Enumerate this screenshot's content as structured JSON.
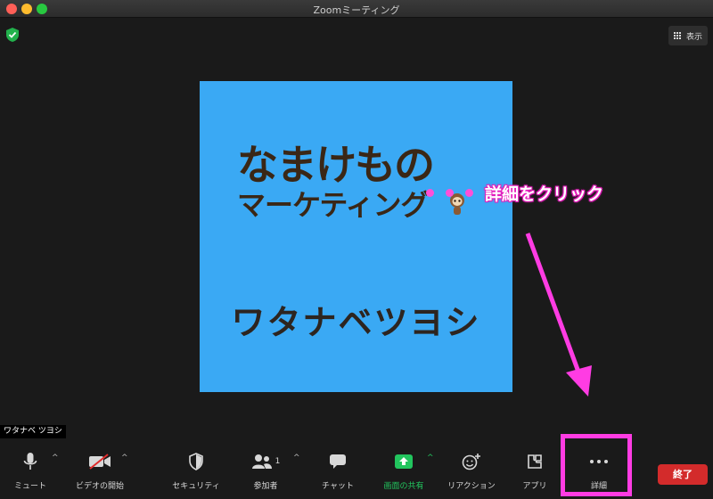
{
  "window": {
    "title": "Zoomミーティング"
  },
  "header": {
    "view_label": "表示"
  },
  "participant": {
    "logo_line1": "なまけもの",
    "logo_line2": "マーケティング",
    "display_name": "ワタナベツヨシ",
    "name_tag": "ワタナベ ツヨシ"
  },
  "annotation": {
    "label": "詳細をクリック"
  },
  "toolbar": {
    "items": [
      {
        "label": "ミュート",
        "icon": "microphone-icon"
      },
      {
        "label": "ビデオの開始",
        "icon": "video-off-icon"
      },
      {
        "label": "セキュリティ",
        "icon": "shield-icon"
      },
      {
        "label": "参加者",
        "icon": "participants-icon",
        "count": "1"
      },
      {
        "label": "チャット",
        "icon": "chat-icon"
      },
      {
        "label": "画面の共有",
        "icon": "share-screen-icon"
      },
      {
        "label": "リアクション",
        "icon": "reaction-icon"
      },
      {
        "label": "アプリ",
        "icon": "apps-icon"
      },
      {
        "label": "詳細",
        "icon": "more-icon"
      }
    ],
    "end_label": "終了"
  },
  "colors": {
    "background": "#1a1a1a",
    "avatar_bg": "#3aa9f4",
    "share_green": "#22c55e",
    "end_red": "#d32b2b",
    "annotation_pink": "#ff3ce3"
  }
}
